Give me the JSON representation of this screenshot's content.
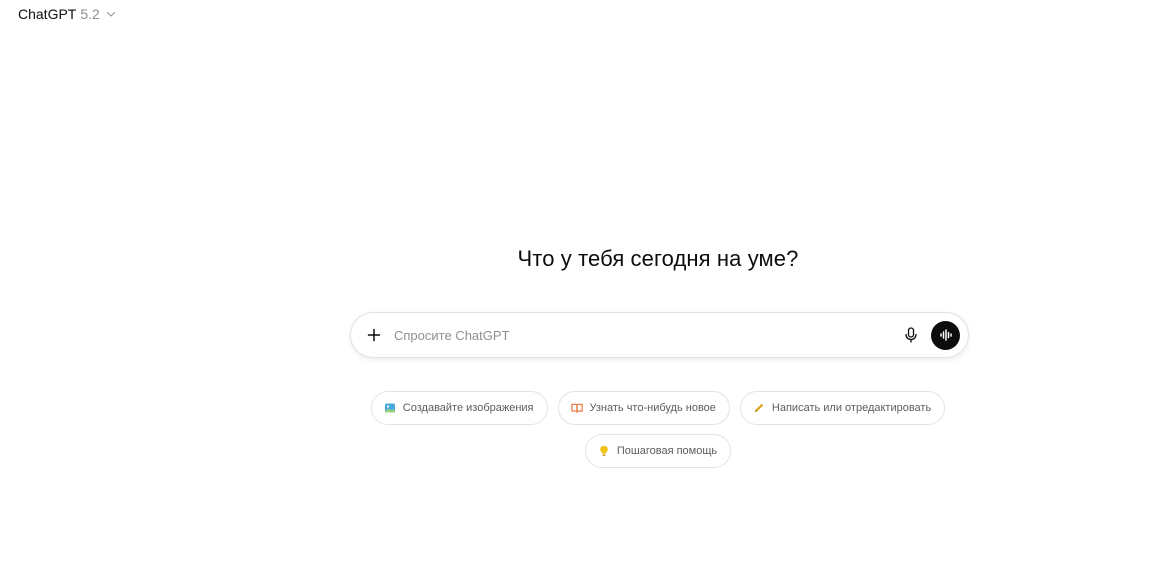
{
  "header": {
    "model_name": "ChatGPT",
    "model_version": "5.2",
    "chevron_icon": "chevron-down-icon"
  },
  "main": {
    "headline": "Что у тебя сегодня на уме?"
  },
  "composer": {
    "placeholder": "Спросите ChatGPT",
    "value": "",
    "add_icon": "plus-icon",
    "mic_icon": "microphone-icon",
    "voice_icon": "voice-waveform-icon"
  },
  "suggestions": [
    {
      "label": "Создавайте изображения",
      "icon": "image-icon",
      "color": "#4aa8e0"
    },
    {
      "label": "Узнать что-нибудь новое",
      "icon": "open-book-icon",
      "color": "#e8733a"
    },
    {
      "label": "Написать или отредактировать",
      "icon": "pencil-icon",
      "color": "#e0a528"
    },
    {
      "label": "Пошаговая помощь",
      "icon": "lightbulb-icon",
      "color": "#f2c21b"
    }
  ],
  "colors": {
    "text": "#0d0d0d",
    "muted": "#8e8e8e",
    "border": "#e3e3e3",
    "voice_button": "#0d0d0d"
  }
}
